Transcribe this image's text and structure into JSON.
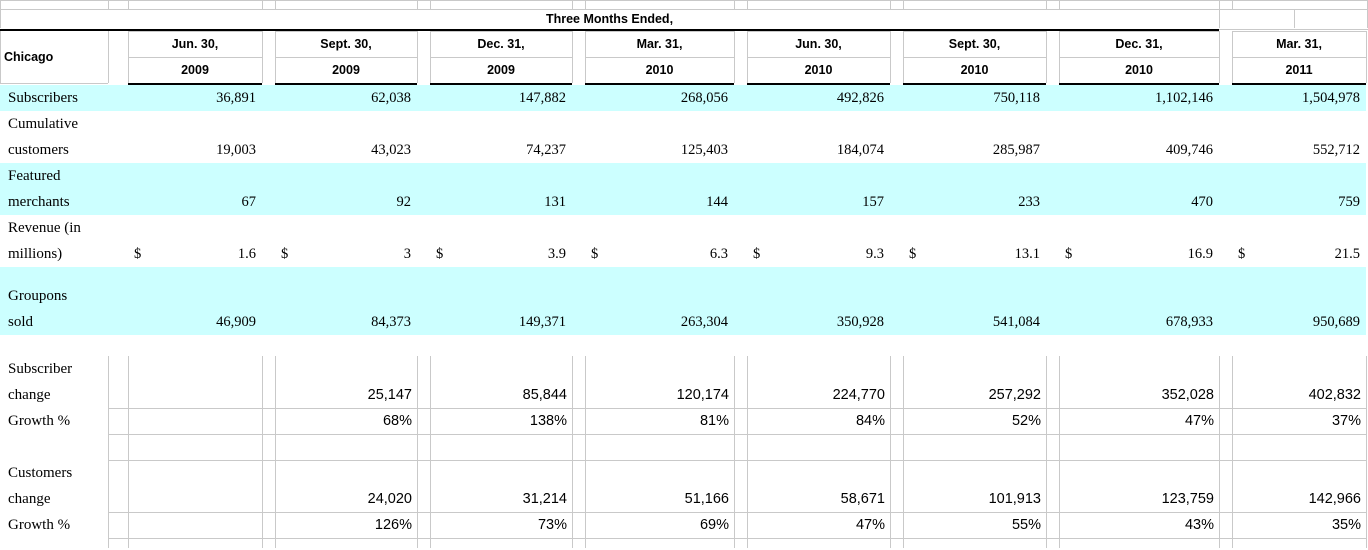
{
  "sheet": {
    "title_row": {
      "label": "Three Months Ended,"
    },
    "corner_label": "Chicago",
    "accent_band_color": "#ccffff",
    "grid_color": "#c9c9c9",
    "rule_color": "#000000"
  },
  "columns": [
    {
      "month": "Jun. 30,",
      "year": "2009"
    },
    {
      "month": "Sept. 30,",
      "year": "2009"
    },
    {
      "month": "Dec. 31,",
      "year": "2009"
    },
    {
      "month": "Mar. 31,",
      "year": "2010"
    },
    {
      "month": "Jun. 30,",
      "year": "2010"
    },
    {
      "month": "Sept. 30,",
      "year": "2010"
    },
    {
      "month": "Dec. 31,",
      "year": "2010"
    },
    {
      "month": "Mar. 31,",
      "year": "2011"
    }
  ],
  "metrics": [
    {
      "label_line1": "Subscribers",
      "label_line2": "",
      "currency": false,
      "shaded": true,
      "values": [
        "36,891",
        "62,038",
        "147,882",
        "268,056",
        "492,826",
        "750,118",
        "1,102,146",
        "1,504,978"
      ]
    },
    {
      "label_line1": "Cumulative",
      "label_line2": "customers",
      "currency": false,
      "shaded": false,
      "values": [
        "19,003",
        "43,023",
        "74,237",
        "125,403",
        "184,074",
        "285,987",
        "409,746",
        "552,712"
      ]
    },
    {
      "label_line1": "Featured",
      "label_line2": "merchants",
      "currency": false,
      "shaded": true,
      "values": [
        "67",
        "92",
        "131",
        "144",
        "157",
        "233",
        "470",
        "759"
      ]
    },
    {
      "label_line1": "Revenue (in",
      "label_line2": "millions)",
      "currency": true,
      "currency_symbol": "$",
      "shaded": false,
      "values": [
        "1.6",
        "3",
        "3.9",
        "6.3",
        "9.3",
        "13.1",
        "16.9",
        "21.5"
      ]
    },
    {
      "label_line1": "Groupons",
      "label_line2": "sold",
      "currency": false,
      "shaded": true,
      "values": [
        "46,909",
        "84,373",
        "149,371",
        "263,304",
        "350,928",
        "541,084",
        "678,933",
        "950,689"
      ]
    }
  ],
  "derived": [
    {
      "label_line1": "Subscriber",
      "label_line2": "change",
      "values": [
        "",
        "25,147",
        "85,844",
        "120,174",
        "224,770",
        "257,292",
        "352,028",
        "402,832"
      ]
    },
    {
      "label_line1": "Growth %",
      "label_line2": "",
      "values": [
        "",
        "68%",
        "138%",
        "81%",
        "84%",
        "52%",
        "47%",
        "37%"
      ]
    },
    {
      "label_line1": "",
      "label_line2": "",
      "values": [
        "",
        "",
        "",
        "",
        "",
        "",
        "",
        ""
      ]
    },
    {
      "label_line1": "Customers",
      "label_line2": "change",
      "values": [
        "",
        "24,020",
        "31,214",
        "51,166",
        "58,671",
        "101,913",
        "123,759",
        "142,966"
      ]
    },
    {
      "label_line1": "Growth %",
      "label_line2": "",
      "values": [
        "",
        "126%",
        "73%",
        "69%",
        "47%",
        "55%",
        "43%",
        "35%"
      ]
    }
  ]
}
